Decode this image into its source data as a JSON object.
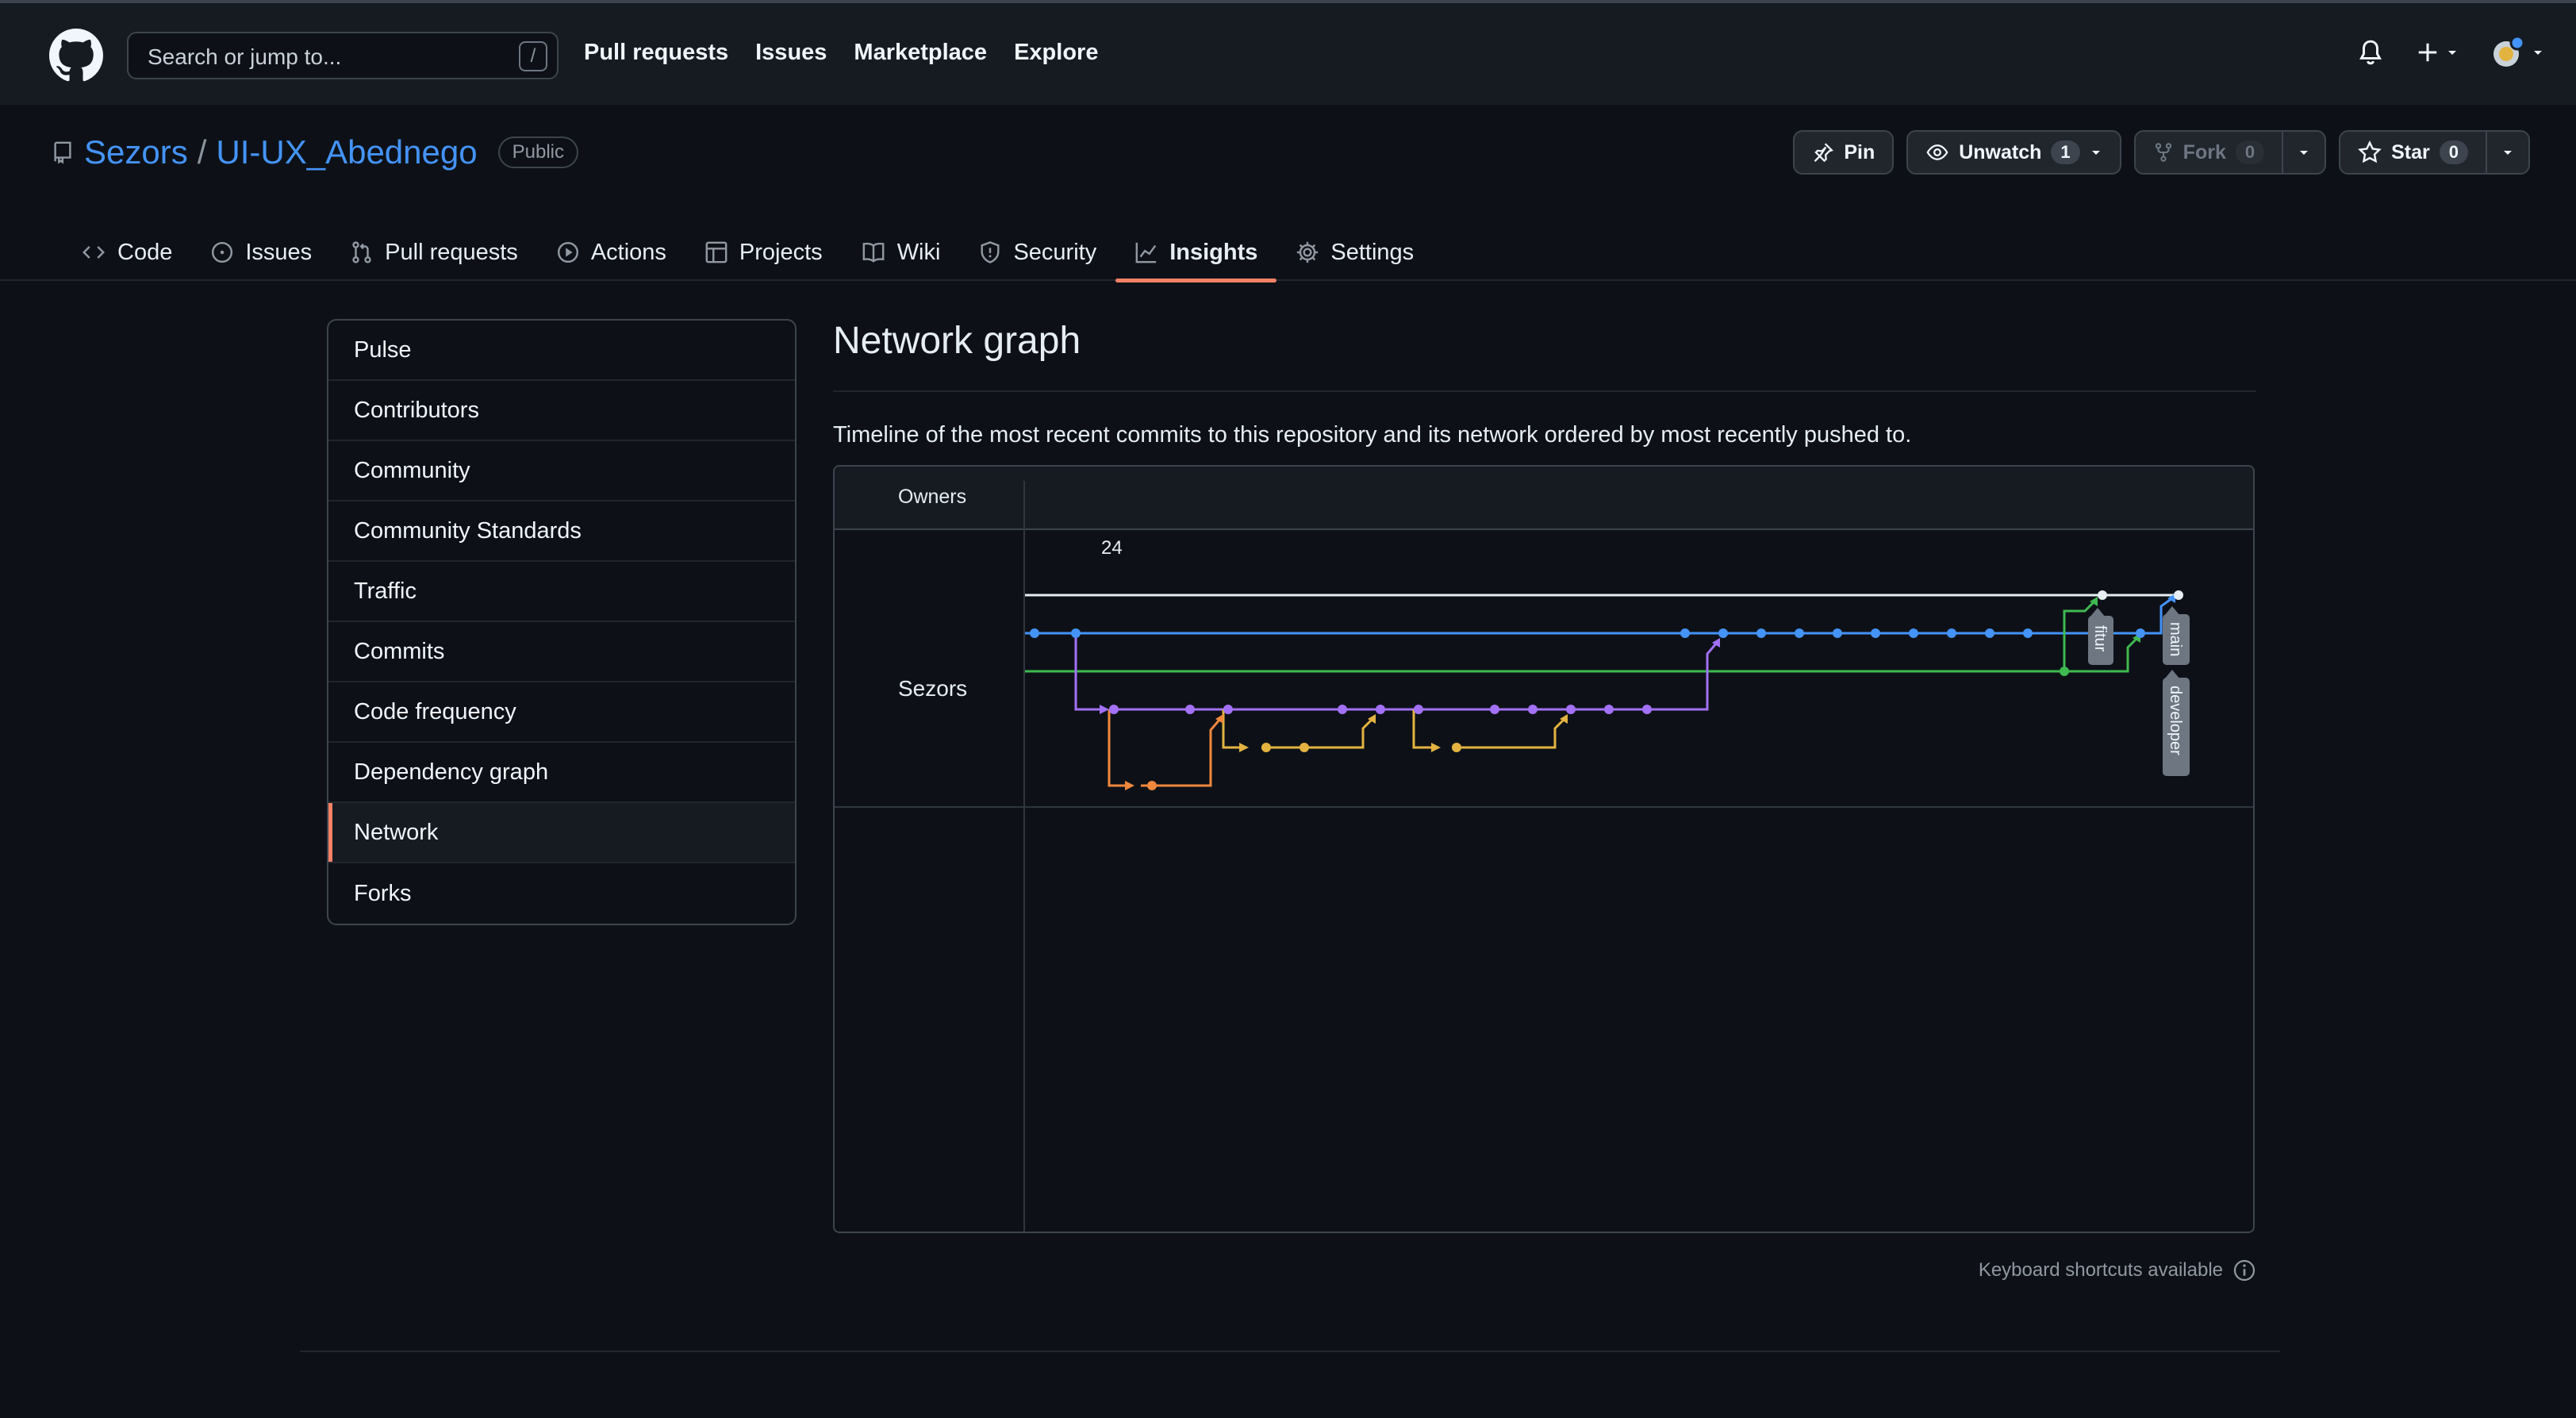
{
  "header": {
    "search_placeholder": "Search or jump to...",
    "search_shortcut": "/",
    "nav": [
      "Pull requests",
      "Issues",
      "Marketplace",
      "Explore"
    ]
  },
  "repo": {
    "owner": "Sezors",
    "separator": "/",
    "name": "UI-UX_Abednego",
    "visibility": "Public",
    "pin_label": "Pin",
    "unwatch_label": "Unwatch",
    "unwatch_count": "1",
    "fork_label": "Fork",
    "fork_count": "0",
    "star_label": "Star",
    "star_count": "0"
  },
  "tabs": [
    {
      "label": "Code",
      "icon": "code-icon"
    },
    {
      "label": "Issues",
      "icon": "issue-icon"
    },
    {
      "label": "Pull requests",
      "icon": "pull-request-icon"
    },
    {
      "label": "Actions",
      "icon": "play-icon"
    },
    {
      "label": "Projects",
      "icon": "table-icon"
    },
    {
      "label": "Wiki",
      "icon": "book-icon"
    },
    {
      "label": "Security",
      "icon": "shield-icon"
    },
    {
      "label": "Insights",
      "icon": "graph-icon",
      "active": true
    },
    {
      "label": "Settings",
      "icon": "gear-icon"
    }
  ],
  "sidebar": {
    "items": [
      "Pulse",
      "Contributors",
      "Community",
      "Community Standards",
      "Traffic",
      "Commits",
      "Code frequency",
      "Dependency graph",
      "Network",
      "Forks"
    ],
    "active": "Network"
  },
  "main": {
    "title": "Network graph",
    "description": "Timeline of the most recent commits to this repository and its network ordered by most recently pushed to.",
    "owners_header": "Owners",
    "owner": "Sezors",
    "date_label": "24",
    "branch_labels": [
      "fitur",
      "main",
      "developer"
    ],
    "keyboard_shortcuts": "Keyboard shortcuts available"
  },
  "colors": {
    "white_branch": "#e6edf3",
    "blue_branch": "#4493f8",
    "green_branch": "#3fb950",
    "purple_branch": "#a371f7",
    "orange_branch": "#f0883e",
    "yellow_branch": "#e3b341",
    "accent_underline": "#f78166"
  }
}
